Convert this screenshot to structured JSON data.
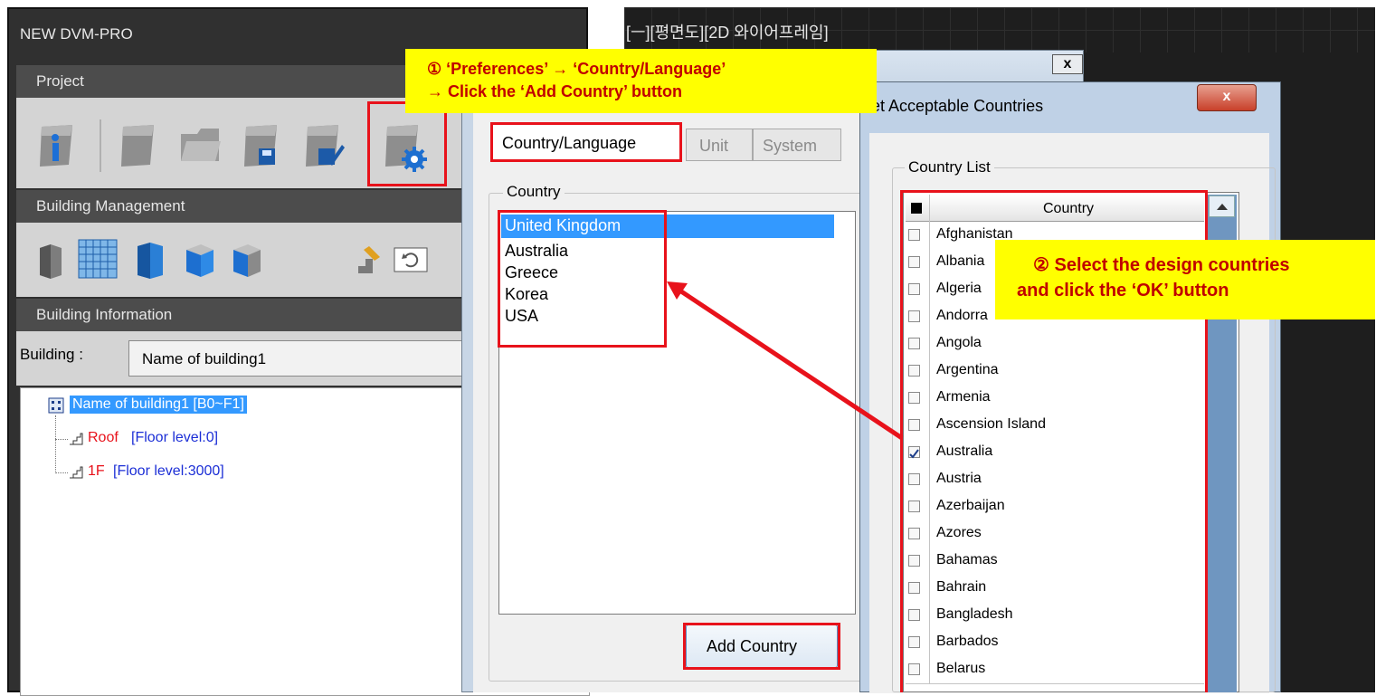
{
  "left_panel": {
    "title": "NEW DVM-PRO",
    "sections": [
      "Project",
      "Building Management",
      "Building Information"
    ],
    "building_label": "Building :",
    "building_value": "Name of building1",
    "tree": {
      "root": "Name of building1 [B0~F1]",
      "children": [
        {
          "name": "Roof",
          "level": "[Floor level:0]"
        },
        {
          "name": "1F",
          "level": "[Floor level:3000]"
        }
      ]
    }
  },
  "background_title": "[ㅡ][평면도][2D 와이어프레임]",
  "pref_dialog": {
    "tabs": [
      "Country/Language",
      "Unit",
      "System"
    ],
    "group_label": "Country",
    "countries": [
      "United Kingdom",
      "Australia",
      "Greece",
      "Korea",
      "USA"
    ],
    "add_button": "Add Country"
  },
  "country_dialog": {
    "title": "et Acceptable Countries",
    "group_label": "Country List",
    "column_header": "Country",
    "rows": [
      {
        "name": "Afghanistan",
        "checked": false
      },
      {
        "name": "Albania",
        "checked": false
      },
      {
        "name": "Algeria",
        "checked": false
      },
      {
        "name": "Andorra",
        "checked": false
      },
      {
        "name": "Angola",
        "checked": false
      },
      {
        "name": "Argentina",
        "checked": false
      },
      {
        "name": "Armenia",
        "checked": false
      },
      {
        "name": "Ascension Island",
        "checked": false
      },
      {
        "name": "Australia",
        "checked": true
      },
      {
        "name": "Austria",
        "checked": false
      },
      {
        "name": "Azerbaijan",
        "checked": false
      },
      {
        "name": "Azores",
        "checked": false
      },
      {
        "name": "Bahamas",
        "checked": false
      },
      {
        "name": "Bahrain",
        "checked": false
      },
      {
        "name": "Bangladesh",
        "checked": false
      },
      {
        "name": "Barbados",
        "checked": false
      },
      {
        "name": "Belarus",
        "checked": false
      }
    ]
  },
  "annotations": {
    "note1_line1": "① ‘Preferences’ → ‘Country/Language’",
    "note1_line2": "→ Click the ‘Add Country’ button",
    "note2_line1": "② Select the design countries",
    "note2_line2": "and click the ‘OK’ button"
  },
  "colors": {
    "accent_red": "#e8121b",
    "note_yellow": "#ffff00",
    "selection_blue": "#3399ff"
  }
}
